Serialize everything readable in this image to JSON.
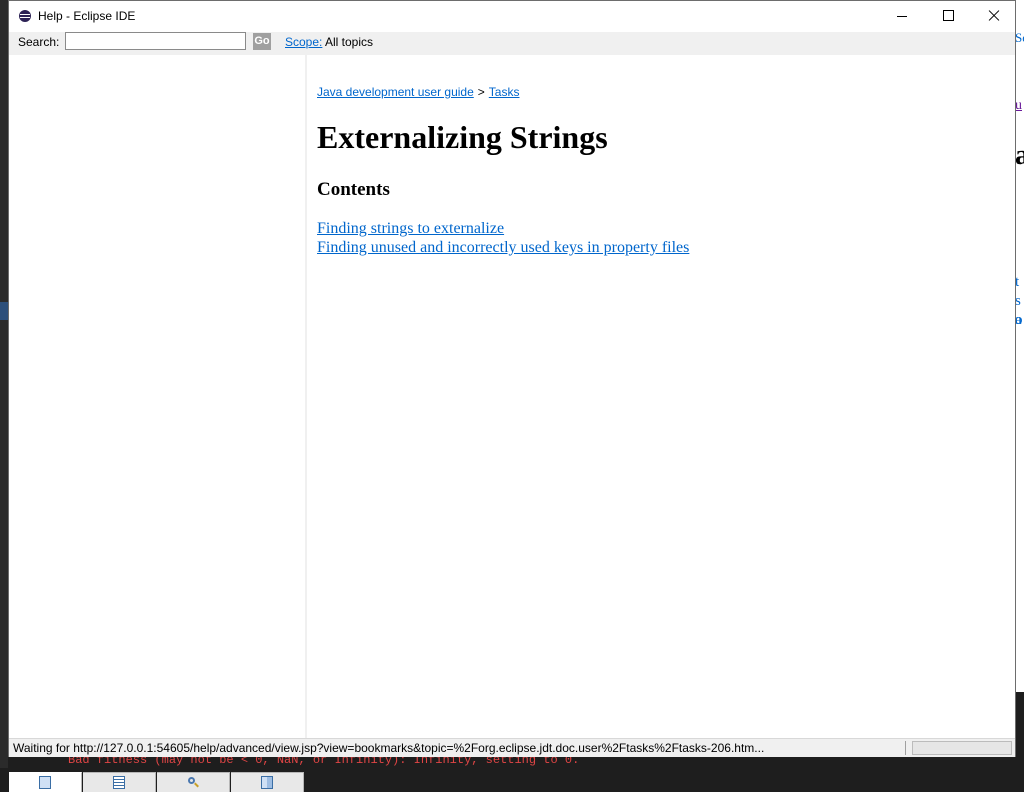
{
  "window": {
    "title": "Help - Eclipse IDE"
  },
  "search": {
    "label": "Search:",
    "value": "",
    "go_label": "Go",
    "scope_link": "Scope:",
    "scope_value": "All topics"
  },
  "breadcrumb": {
    "items": [
      "Java development user guide",
      "Tasks"
    ],
    "separator": ">"
  },
  "page": {
    "title": "Externalizing Strings",
    "contents_heading": "Contents",
    "links": [
      "Finding strings to externalize",
      "Finding unused and incorrectly used keys in property files"
    ]
  },
  "nav_tabs": [
    {
      "icon": "contents-icon",
      "active": true
    },
    {
      "icon": "index-icon",
      "active": false
    },
    {
      "icon": "search-results-icon",
      "active": false
    },
    {
      "icon": "bookmarks-icon",
      "active": false
    }
  ],
  "status": {
    "text": "Waiting for http://127.0.0.1:54605/help/advanced/view.jsp?view=bookmarks&topic=%2Forg.eclipse.jdt.doc.user%2Ftasks%2Ftasks-206.htm..."
  },
  "background": {
    "console_text": "Bad fitness (may not be < 0, NaN, or Infinity): Infinity, setting to 0.",
    "right_fragments": [
      "Se",
      "u",
      "a",
      "t",
      "s a",
      "o"
    ]
  },
  "colors": {
    "link": "#0066cc",
    "status_bg": "#f0f0f0",
    "console_error": "#e04545"
  }
}
